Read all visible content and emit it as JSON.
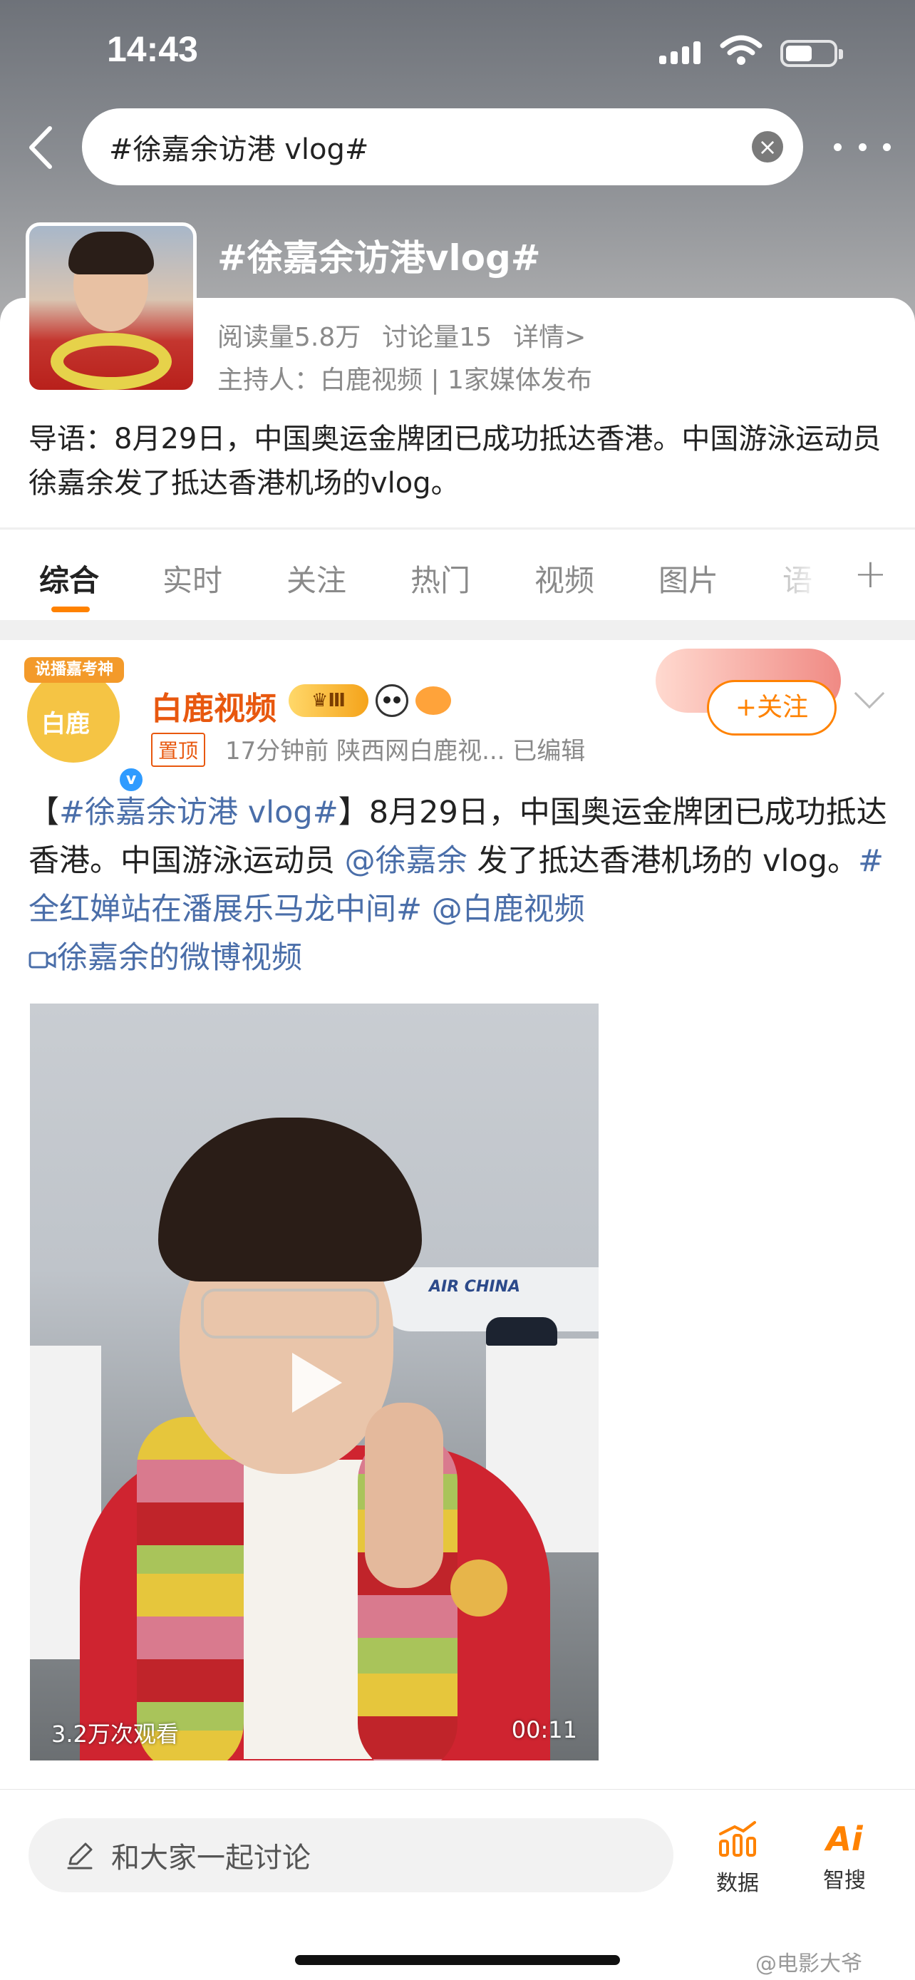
{
  "status_bar": {
    "time": "14:43"
  },
  "search": {
    "query": "#徐嘉余访港 vlog#"
  },
  "topic": {
    "title": "#徐嘉余访港vlog#",
    "reads": "阅读量5.8万",
    "discussions": "讨论量15",
    "details_link": "详情>",
    "host_line": "主持人：白鹿视频 | 1家媒体发布",
    "intro": "导语：8月29日，中国奥运金牌团已成功抵达香港。中国游泳运动员徐嘉余发了抵达香港机场的vlog。"
  },
  "tabs": [
    {
      "label": "综合"
    },
    {
      "label": "实时"
    },
    {
      "label": "关注"
    },
    {
      "label": "热门"
    },
    {
      "label": "视频"
    },
    {
      "label": "图片"
    },
    {
      "label": "语"
    }
  ],
  "tab_add": "+",
  "post": {
    "avatar_text": "白鹿",
    "avatar_banner": "说播嘉考神",
    "author": "白鹿视频",
    "vip_level": "Ⅲ",
    "pinned": "置顶",
    "meta": "17分钟前  陕西网白鹿视...  已编辑",
    "follow_label": "+关注",
    "text": {
      "bracket_open": "【",
      "topic_link": "#徐嘉余访港 vlog#",
      "bracket_close": "】",
      "part1": "8月29日，中国奥运金牌团已成功抵达香港。中国游泳运动员 ",
      "mention": "@徐嘉余",
      "part2": " 发了抵达香港机场的 vlog。",
      "topic_link2": "#全红婵站在潘展乐马龙中间#",
      "mention2": " @白鹿视频",
      "video_link": "徐嘉余的微博视频"
    },
    "video": {
      "views": "3.2万次观看",
      "duration": "00:11",
      "plane_text": "AIR CHINA"
    }
  },
  "bottom_bar": {
    "comment_placeholder": "和大家一起讨论",
    "data_label": "数据",
    "ai_label": "智搜",
    "ai_mark": "Ai"
  },
  "watermark": "@电影大爷",
  "colors": {
    "accent": "#ff8200",
    "link": "#4a6ea9",
    "author": "#e8580f"
  }
}
